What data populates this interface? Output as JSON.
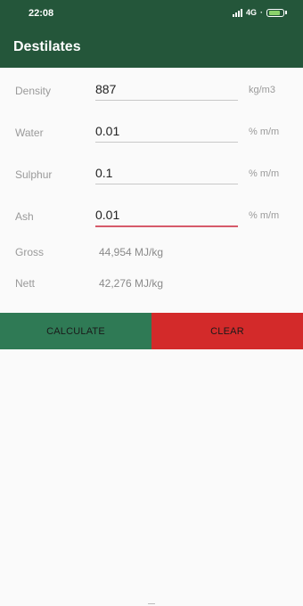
{
  "status": {
    "time": "22:08",
    "network": "4G"
  },
  "app_bar": {
    "title": "Destilates"
  },
  "fields": [
    {
      "label": "Density",
      "value": "887",
      "unit": "kg/m3"
    },
    {
      "label": "Water",
      "value": "0.01",
      "unit": "% m/m"
    },
    {
      "label": "Sulphur",
      "value": "0.1",
      "unit": "% m/m"
    },
    {
      "label": "Ash",
      "value": "0.01",
      "unit": "% m/m"
    }
  ],
  "results": [
    {
      "label": "Gross",
      "value": "44,954 MJ/kg"
    },
    {
      "label": "Nett",
      "value": "42,276 MJ/kg"
    }
  ],
  "buttons": {
    "calculate": "CALCULATE",
    "clear": "CLEAR"
  },
  "colors": {
    "primary": "#24563a",
    "calculate": "#2f7a55",
    "clear": "#d32a2a",
    "focus_underline": "#d65a6a"
  }
}
